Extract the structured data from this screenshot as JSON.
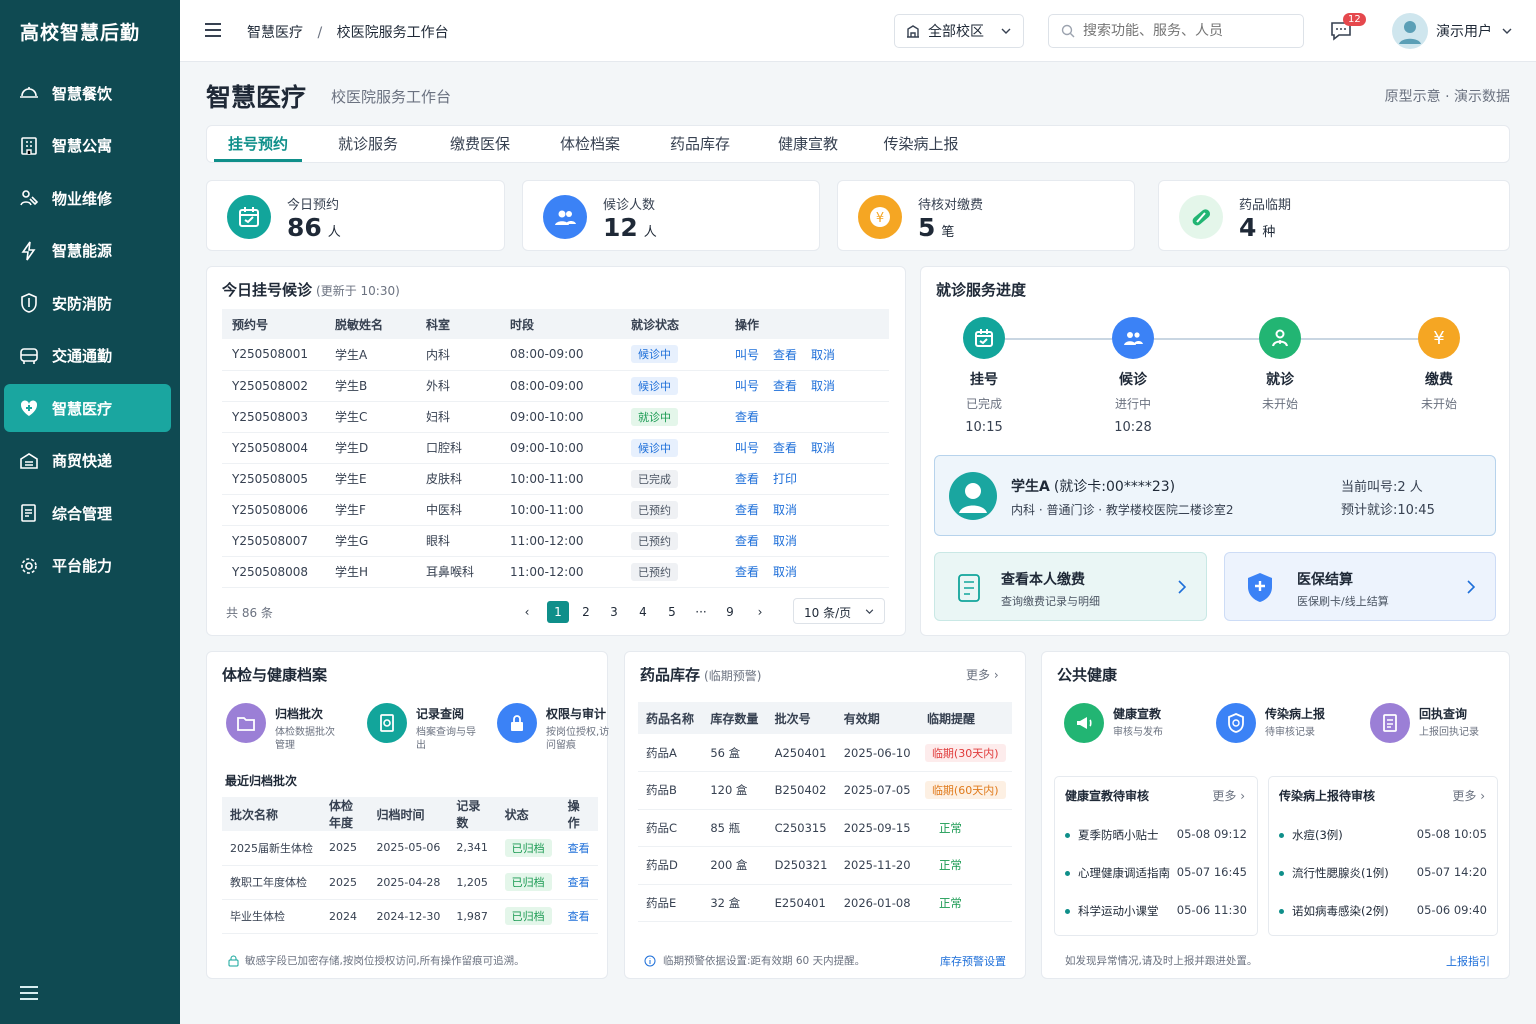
{
  "sidebar": {
    "brand": "高校智慧后勤",
    "items": [
      {
        "label": "智慧餐饮",
        "icon": "dining-icon"
      },
      {
        "label": "智慧公寓",
        "icon": "apartment-icon"
      },
      {
        "label": "物业维修",
        "icon": "repair-icon"
      },
      {
        "label": "智慧能源",
        "icon": "energy-icon"
      },
      {
        "label": "安防消防",
        "icon": "shield-icon"
      },
      {
        "label": "交通通勤",
        "icon": "bus-icon"
      },
      {
        "label": "智慧医疗",
        "icon": "medical-icon"
      },
      {
        "label": "商贸快递",
        "icon": "delivery-icon"
      },
      {
        "label": "综合管理",
        "icon": "document-icon"
      },
      {
        "label": "平台能力",
        "icon": "gear-icon"
      }
    ]
  },
  "topbar": {
    "breadcrumb_1": "智慧医疗",
    "breadcrumb_sep": "/",
    "breadcrumb_2": "校医院服务工作台",
    "campus_label": "全部校区",
    "search_placeholder": "搜索功能、服务、人员",
    "message_count": "12",
    "user_name": "演示用户"
  },
  "page": {
    "title": "智慧医疗",
    "subtitle": "校医院服务工作台",
    "note": "原型示意 · 演示数据"
  },
  "tabs": [
    "挂号预约",
    "就诊服务",
    "缴费医保",
    "体检档案",
    "药品库存",
    "健康宣教",
    "传染病上报"
  ],
  "stats": [
    {
      "label": "今日预约",
      "value": "86",
      "unit": "人",
      "color": "#12a59b"
    },
    {
      "label": "候诊人数",
      "value": "12",
      "unit": "人",
      "color": "#3b82f6"
    },
    {
      "label": "待核对缴费",
      "value": "5",
      "unit": "笔",
      "color": "#f5a623"
    },
    {
      "label": "药品临期",
      "value": "4",
      "unit": "种",
      "color": "#22b573"
    }
  ],
  "queue": {
    "title": "今日挂号候诊",
    "updated": "(更新于 10:30)",
    "headers": [
      "预约号",
      "脱敏姓名",
      "科室",
      "时段",
      "就诊状态",
      "操作"
    ],
    "rows": [
      {
        "id": "Y250508001",
        "name": "学生A",
        "dept": "内科",
        "time": "08:00-09:00",
        "status": "候诊中",
        "tone": "blue",
        "ops": [
          "叫号",
          "查看",
          "取消"
        ]
      },
      {
        "id": "Y250508002",
        "name": "学生B",
        "dept": "外科",
        "time": "08:00-09:00",
        "status": "候诊中",
        "tone": "blue",
        "ops": [
          "叫号",
          "查看",
          "取消"
        ]
      },
      {
        "id": "Y250508003",
        "name": "学生C",
        "dept": "妇科",
        "time": "09:00-10:00",
        "status": "就诊中",
        "tone": "green",
        "ops": [
          "查看"
        ]
      },
      {
        "id": "Y250508004",
        "name": "学生D",
        "dept": "口腔科",
        "time": "09:00-10:00",
        "status": "候诊中",
        "tone": "blue",
        "ops": [
          "叫号",
          "查看",
          "取消"
        ]
      },
      {
        "id": "Y250508005",
        "name": "学生E",
        "dept": "皮肤科",
        "time": "10:00-11:00",
        "status": "已完成",
        "tone": "gray",
        "ops": [
          "查看",
          "打印"
        ]
      },
      {
        "id": "Y250508006",
        "name": "学生F",
        "dept": "中医科",
        "time": "10:00-11:00",
        "status": "已预约",
        "tone": "gray",
        "ops": [
          "查看",
          "取消"
        ]
      },
      {
        "id": "Y250508007",
        "name": "学生G",
        "dept": "眼科",
        "time": "11:00-12:00",
        "status": "已预约",
        "tone": "gray",
        "ops": [
          "查看",
          "取消"
        ]
      },
      {
        "id": "Y250508008",
        "name": "学生H",
        "dept": "耳鼻喉科",
        "time": "11:00-12:00",
        "status": "已预约",
        "tone": "gray",
        "ops": [
          "查看",
          "取消"
        ]
      }
    ],
    "total": "共 86 条",
    "pages": [
      "1",
      "2",
      "3",
      "4",
      "5",
      "···",
      "9"
    ],
    "page_size": "10 条/页"
  },
  "progress": {
    "title": "就诊服务进度",
    "steps": [
      {
        "name": "挂号",
        "status": "已完成",
        "time": "10:15",
        "color": "#12a59b"
      },
      {
        "name": "候诊",
        "status": "进行中",
        "time": "10:28",
        "color": "#3b82f6"
      },
      {
        "name": "就诊",
        "status": "未开始",
        "time": "",
        "color": "#22b573"
      },
      {
        "name": "缴费",
        "status": "未开始",
        "time": "",
        "color": "#f5a623"
      }
    ],
    "patient_name": "学生A",
    "patient_card": "(就诊卡:00****23)",
    "patient_detail": "内科 · 普通门诊 · 教学楼校医院二楼诊室2",
    "current_call": "当前叫号:2 人",
    "expected": "预计就诊:10:45",
    "card1_title": "查看本人缴费",
    "card1_sub": "查询缴费记录与明细",
    "card2_title": "医保结算",
    "card2_sub": "医保刷卡/线上结算"
  },
  "exam": {
    "title": "体检与健康档案",
    "features": [
      {
        "title": "归档批次",
        "sub": "体检数据批次管理",
        "color": "#9b7fd6"
      },
      {
        "title": "记录查阅",
        "sub": "档案查询与导出",
        "color": "#12a59b"
      },
      {
        "title": "权限与审计",
        "sub": "按岗位授权,访问留痕",
        "color": "#3b82f6"
      }
    ],
    "recent_title": "最近归档批次",
    "headers": [
      "批次名称",
      "体检年度",
      "归档时间",
      "记录数",
      "状态",
      "操作"
    ],
    "rows": [
      {
        "name": "2025届新生体检",
        "year": "2025",
        "date": "2025-05-06",
        "count": "2,341",
        "status": "已归档",
        "op": "查看"
      },
      {
        "name": "教职工年度体检",
        "year": "2025",
        "date": "2025-04-28",
        "count": "1,205",
        "status": "已归档",
        "op": "查看"
      },
      {
        "name": "毕业生体检",
        "year": "2024",
        "date": "2024-12-30",
        "count": "1,987",
        "status": "已归档",
        "op": "查看"
      }
    ],
    "footer": "敏感字段已加密存储,按岗位授权访问,所有操作留痕可追溯。"
  },
  "drugs": {
    "title": "药品库存",
    "subtitle": "(临期预警)",
    "more": "更多",
    "headers": [
      "药品名称",
      "库存数量",
      "批次号",
      "有效期",
      "临期提醒"
    ],
    "rows": [
      {
        "name": "药品A",
        "qty": "56 盒",
        "batch": "A250401",
        "exp": "2025-06-10",
        "alert": "临期(30天内)",
        "tone": "red"
      },
      {
        "name": "药品B",
        "qty": "120 盒",
        "batch": "B250402",
        "exp": "2025-07-05",
        "alert": "临期(60天内)",
        "tone": "orange"
      },
      {
        "name": "药品C",
        "qty": "85 瓶",
        "batch": "C250315",
        "exp": "2025-09-15",
        "alert": "正常",
        "tone": "ok"
      },
      {
        "name": "药品D",
        "qty": "200 盒",
        "batch": "D250321",
        "exp": "2025-11-20",
        "alert": "正常",
        "tone": "ok"
      },
      {
        "name": "药品E",
        "qty": "32 盒",
        "batch": "E250401",
        "exp": "2026-01-08",
        "alert": "正常",
        "tone": "ok"
      }
    ],
    "footer": "临期预警依据设置:距有效期 60 天内提醒。",
    "footer_link": "库存预警设置"
  },
  "health": {
    "title": "公共健康",
    "features": [
      {
        "title": "健康宣教",
        "sub": "审核与发布",
        "color": "#22b573"
      },
      {
        "title": "传染病上报",
        "sub": "待审核记录",
        "color": "#3b82f6"
      },
      {
        "title": "回执查询",
        "sub": "上报回执记录",
        "color": "#9b7fd6"
      }
    ],
    "list1": {
      "title": "健康宣教待审核",
      "more": "更多",
      "items": [
        {
          "text": "夏季防晒小贴士",
          "time": "05-08 09:12"
        },
        {
          "text": "心理健康调适指南",
          "time": "05-07 16:45"
        },
        {
          "text": "科学运动小课堂",
          "time": "05-06 11:30"
        }
      ]
    },
    "list2": {
      "title": "传染病上报待审核",
      "more": "更多",
      "items": [
        {
          "text": "水痘(3例)",
          "time": "05-08 10:05"
        },
        {
          "text": "流行性腮腺炎(1例)",
          "time": "05-07 14:20"
        },
        {
          "text": "诺如病毒感染(2例)",
          "time": "05-06 09:40"
        }
      ]
    },
    "footer": "如发现异常情况,请及时上报并跟进处置。",
    "footer_link": "上报指引"
  }
}
